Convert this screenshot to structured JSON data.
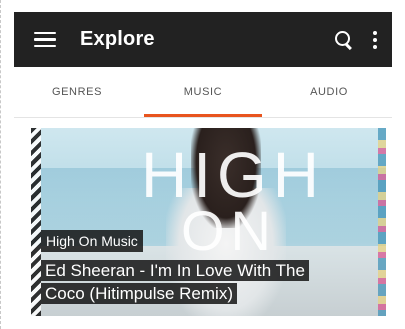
{
  "appbar": {
    "title": "Explore",
    "menu_icon": "menu-icon",
    "search_icon": "search-icon",
    "more_icon": "more-vert-icon",
    "background": "#222222"
  },
  "tabs": [
    {
      "label": "GENRES",
      "active": false
    },
    {
      "label": "MUSIC",
      "active": true
    },
    {
      "label": "AUDIO",
      "active": false
    }
  ],
  "accent_color": "#e8541e",
  "card": {
    "subtitle": "High On Music",
    "title": "Ed Sheeran - I'm In Love With The Coco (Hitimpulse Remix)",
    "image_text_line1": "HIGH",
    "image_text_line2": "ON"
  }
}
